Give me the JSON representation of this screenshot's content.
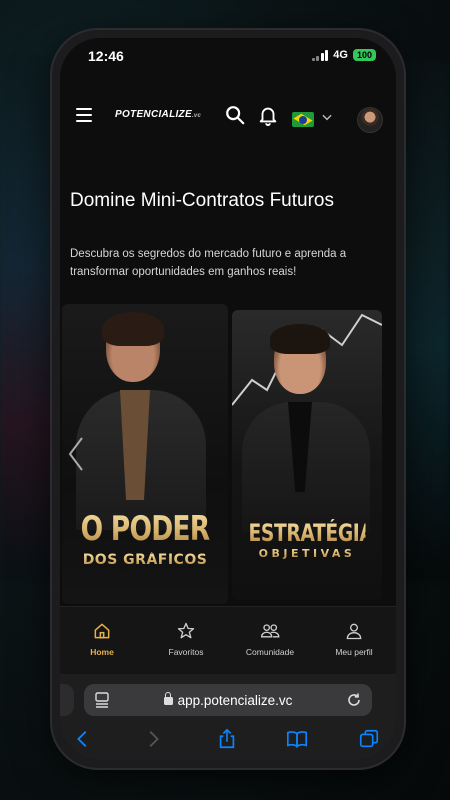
{
  "status_bar": {
    "time": "12:46",
    "network": "4G",
    "battery": "100"
  },
  "header": {
    "logo_text": "POTENCIALIZE",
    "logo_suffix": ".vc",
    "language_flag": "brazil-flag",
    "icons": [
      "menu-icon",
      "search-icon",
      "bell-icon",
      "chevron-down-icon",
      "avatar"
    ]
  },
  "hero": {
    "title": "Domine Mini-Contratos Futuros",
    "subtitle": "Descubra os segredos do mercado futuro e aprenda a transformar oportunidades em ganhos reais!"
  },
  "carousel": {
    "cards": [
      {
        "title_line1": "O PODER",
        "title_line2": "DOS GRÁFICOS"
      },
      {
        "title_line1": "ESTRATÉGIAS",
        "title_line2": "OBJETIVAS"
      }
    ]
  },
  "tabbar": {
    "items": [
      {
        "label": "Home",
        "icon": "home-icon",
        "active": true
      },
      {
        "label": "Favoritos",
        "icon": "star-icon",
        "active": false
      },
      {
        "label": "Comunidade",
        "icon": "community-icon",
        "active": false
      },
      {
        "label": "Meu perfil",
        "icon": "profile-icon",
        "active": false
      }
    ]
  },
  "browser": {
    "url": "app.potencialize.vc"
  },
  "colors": {
    "accent": "#e8b04a",
    "ios_blue": "#0a84ff",
    "battery_green": "#34c759"
  }
}
